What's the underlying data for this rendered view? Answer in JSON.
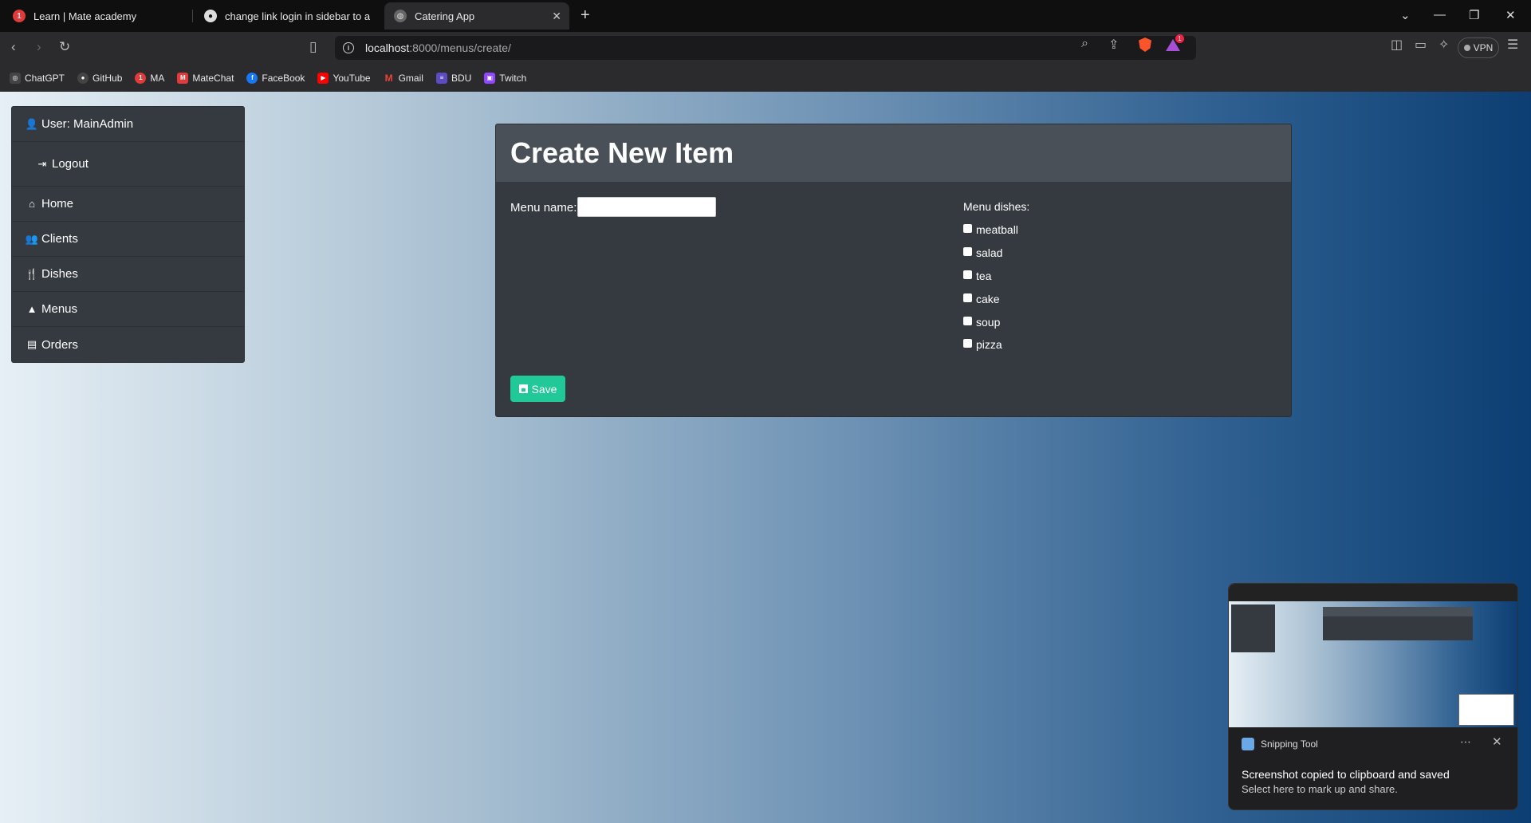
{
  "browser": {
    "tabs": [
      {
        "title": "Learn | Mate academy",
        "badge": "1"
      },
      {
        "title": "change link login in sidebar to avoid"
      },
      {
        "title": "Catering App"
      }
    ],
    "url_host": "localhost",
    "url_path": ":8000/menus/create/",
    "vpn_label": "VPN",
    "shield_badge": "1",
    "bookmarks": [
      {
        "label": "ChatGPT",
        "color": "#444444"
      },
      {
        "label": "GitHub",
        "color": "#444444"
      },
      {
        "label": "MA",
        "color": "#e03a3a",
        "badge": "1"
      },
      {
        "label": "MateChat",
        "color": "#e03a3a"
      },
      {
        "label": "FaceBook",
        "color": "#1877f2"
      },
      {
        "label": "YouTube",
        "color": "#ff0000"
      },
      {
        "label": "Gmail",
        "color": "#ea4335"
      },
      {
        "label": "BDU",
        "color": "#5b4bc4"
      },
      {
        "label": "Twitch",
        "color": "#9146ff"
      }
    ]
  },
  "sidebar": {
    "user_label": "User: MainAdmin",
    "logout_label": "Logout",
    "items": [
      {
        "label": "Home"
      },
      {
        "label": "Clients"
      },
      {
        "label": "Dishes"
      },
      {
        "label": "Menus"
      },
      {
        "label": "Orders"
      }
    ]
  },
  "form": {
    "title": "Create New Item",
    "menu_name_label": "Menu name:",
    "menu_name_value": "",
    "dishes_label": "Menu dishes:",
    "dishes": [
      "meatball",
      "salad",
      "tea",
      "cake",
      "soup",
      "pizza"
    ],
    "save_label": "Save",
    "accent_color": "#20c997"
  },
  "notification": {
    "app_name": "Snipping Tool",
    "title": "Screenshot copied to clipboard and saved",
    "subtitle": "Select here to mark up and share."
  }
}
